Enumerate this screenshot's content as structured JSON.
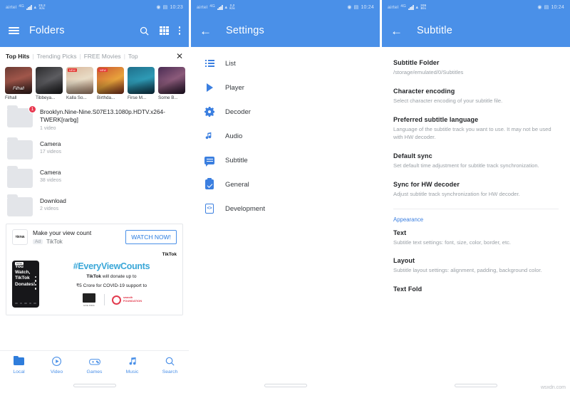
{
  "screens": {
    "folders": {
      "status": {
        "carrier": "airtel",
        "net": "4G",
        "rate_value": "23.2",
        "rate_unit": "K/s",
        "time": "10:23",
        "battery": "84"
      },
      "appbar": {
        "title": "Folders",
        "menu_icon": "hamburger-icon",
        "search_icon": "search-icon",
        "grid_icon": "grid-icon",
        "overflow_icon": "overflow-menu-icon"
      },
      "promo_tabs": {
        "items": [
          "Top Hits",
          "Trending Picks",
          "FREE Movies",
          "Top"
        ],
        "active": "Top Hits",
        "close_label": "✕"
      },
      "posters": [
        {
          "caption": "Filhall",
          "title": "Filhall",
          "ribbon": ""
        },
        {
          "caption": "Tibbeya...",
          "title": "",
          "ribbon": ""
        },
        {
          "caption": "Kalla So...",
          "title": "",
          "ribbon": "NEW"
        },
        {
          "caption": "Birthda...",
          "title": "",
          "ribbon": "NEW"
        },
        {
          "caption": "Firse M...",
          "title": "",
          "ribbon": ""
        },
        {
          "caption": "Some B...",
          "title": "",
          "ribbon": ""
        }
      ],
      "folder_items": [
        {
          "name": "Brooklyn.Nine-Nine.S07E13.1080p.HDTV.x264-TWERK[rarbg]",
          "count": "1 video",
          "badge": "1"
        },
        {
          "name": "Camera",
          "count": "17 videos",
          "badge": ""
        },
        {
          "name": "Camera",
          "count": "38 videos",
          "badge": ""
        },
        {
          "name": "Download",
          "count": "2 videos",
          "badge": ""
        }
      ],
      "ad": {
        "logo_text": "TikTok",
        "headline": "Make your view count",
        "tag": "Ad",
        "advertiser": "TikTok",
        "cta": "WATCH NOW!",
        "brand": "TikTok",
        "phone_chip": "TikTok",
        "phone_line": "You Watch, TikTok Donates!",
        "hashtag": "#EveryViewCounts",
        "copy_line1_bold": "TikTok",
        "copy_line1_rest": " will donate up to",
        "copy_line2": "₹5 Crore for COVID-19 support to",
        "partner_a_caption": "GIVE INDIA",
        "partner_b_line1": "swasth",
        "partner_b_line2": "FOUNDATION"
      },
      "bottom_nav": [
        {
          "label": "Local",
          "icon": "folder-icon",
          "active": true
        },
        {
          "label": "Video",
          "icon": "play-circle-icon",
          "active": false
        },
        {
          "label": "Games",
          "icon": "gamepad-icon",
          "active": false
        },
        {
          "label": "Music",
          "icon": "music-note-icon",
          "active": false
        },
        {
          "label": "Search",
          "icon": "search-icon",
          "active": false
        }
      ]
    },
    "settings": {
      "status": {
        "carrier": "airtel",
        "net": "4G",
        "rate_value": "2.2",
        "rate_unit": "K/s",
        "time": "10:24",
        "battery": "84"
      },
      "appbar": {
        "title": "Settings",
        "back_icon": "back-arrow-icon"
      },
      "items": [
        {
          "label": "List",
          "icon": "list-icon"
        },
        {
          "label": "Player",
          "icon": "play-icon"
        },
        {
          "label": "Decoder",
          "icon": "gear-icon"
        },
        {
          "label": "Audio",
          "icon": "music-note-icon"
        },
        {
          "label": "Subtitle",
          "icon": "subtitle-bubble-icon"
        },
        {
          "label": "General",
          "icon": "clipboard-check-icon"
        },
        {
          "label": "Development",
          "icon": "development-icon"
        }
      ]
    },
    "subtitle": {
      "status": {
        "carrier": "airtel",
        "net": "4G",
        "rate_value": "205",
        "rate_unit": "B/s",
        "time": "10:24",
        "battery": "84"
      },
      "appbar": {
        "title": "Subtitle",
        "back_icon": "back-arrow-icon"
      },
      "items": [
        {
          "title": "Subtitle Folder",
          "desc": "/storage/emulated/0/Subtitles"
        },
        {
          "title": "Character encoding",
          "desc": "Select character encoding of your subtitle file."
        },
        {
          "title": "Preferred subtitle language",
          "desc": "Language of the subtitle track you want to use. It may not be used with HW decoder."
        },
        {
          "title": "Default sync",
          "desc": "Set default time adjustment for subtitle track synchronization."
        },
        {
          "title": "Sync for HW decoder",
          "desc": "Adjust subtitle track synchronization for HW decoder."
        }
      ],
      "section_label": "Appearance",
      "appearance_items": [
        {
          "title": "Text",
          "desc": "Subtitle text settings: font, size, color, border, etc."
        },
        {
          "title": "Layout",
          "desc": "Subtitle layout settings: alignment, padding, background color."
        }
      ],
      "cut_item": {
        "title": "Text Fold",
        "desc": ""
      }
    }
  },
  "watermark": "wsxdn.com",
  "colors": {
    "accent": "#4a90e8",
    "accent_dark": "#3b7fe0",
    "badge": "#e8384f",
    "muted": "#9aa0a6"
  }
}
